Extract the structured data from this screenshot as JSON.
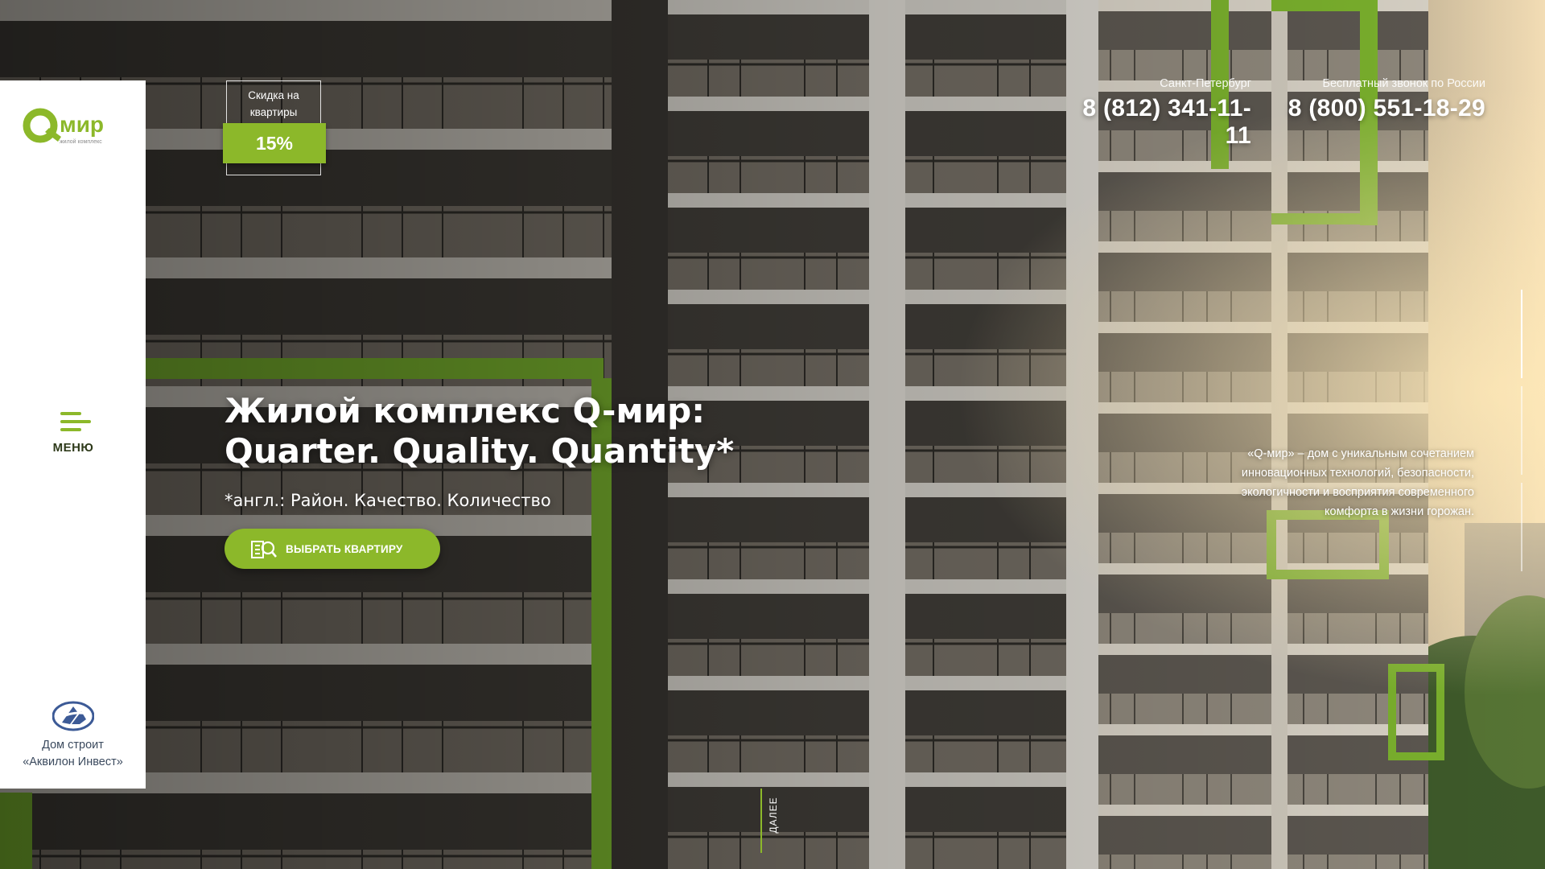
{
  "brand": {
    "logo_text": "мир",
    "logo_letter": "Q",
    "logo_tagline": "жилой комплекс",
    "accent_color": "#8cb82a"
  },
  "menu": {
    "label": "МЕНЮ",
    "icon": "hamburger-icon"
  },
  "builder": {
    "line1": "Дом строит",
    "line2": "«Аквилон Инвест»"
  },
  "discount": {
    "label": "Скидка на квартиры",
    "value": "15%"
  },
  "phones": [
    {
      "city": "Санкт-Петербург",
      "number": "8 (812) 341-11-11"
    },
    {
      "city": "Бесплатный звонок по России",
      "number": "8 (800) 551-18-29"
    }
  ],
  "hero": {
    "title_line1": "Жилой комплекс Q-мир:",
    "title_line2": "Quarter. Quality. Quantity*",
    "subtitle": "*англ.: Район. Качество. Количество",
    "cta_label": "ВЫБРАТЬ КВАРТИРУ",
    "cta_icon": "building-search-icon"
  },
  "description": {
    "line1": "«Q-мир»  – дом с уникальным сочетанием",
    "line2": "инновационных технологий, безопасности,",
    "line3": "экологичности и восприятия современного",
    "line4": "комфорта в жизни горожан."
  },
  "next": {
    "label": "ДАЛЕЕ"
  },
  "pager": {
    "slides": 3,
    "active_index": 0
  }
}
